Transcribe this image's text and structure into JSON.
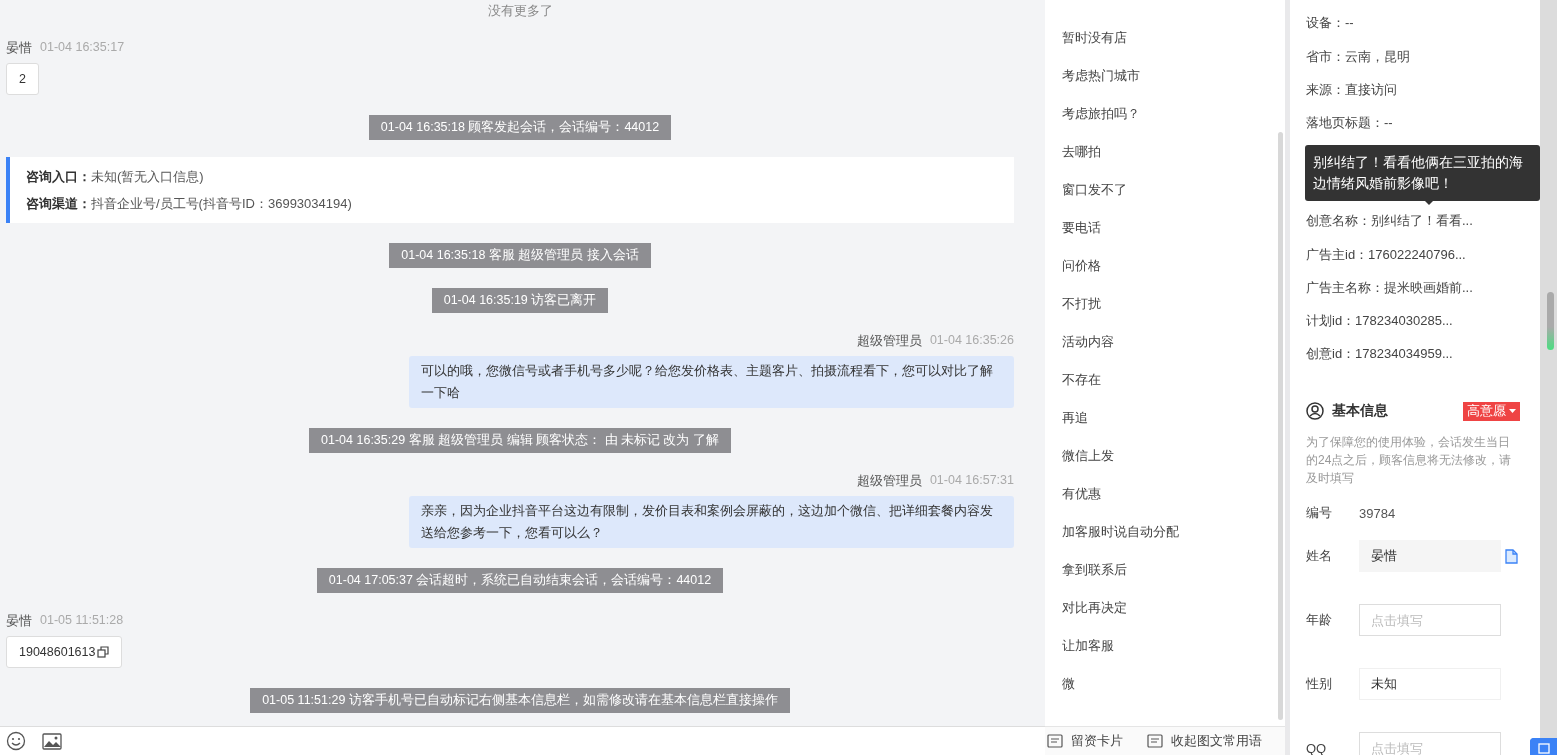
{
  "chat": {
    "end_note": "没有更多了",
    "messages": [
      {
        "kind": "visitor",
        "sender": "晏惜",
        "time": "01-04 16:35:17",
        "text": "2",
        "copy_button": false
      },
      {
        "kind": "system",
        "text": "01-04 16:35:18 顾客发起会话，会话编号：44012"
      },
      {
        "kind": "entry",
        "rows": [
          {
            "label": "咨询入口：",
            "value": "未知(暂无入口信息)"
          },
          {
            "label": "咨询渠道：",
            "value": "抖音企业号/员工号(抖音号ID：36993034194)"
          }
        ]
      },
      {
        "kind": "system",
        "text": "01-04 16:35:18 客服 超级管理员 接入会话"
      },
      {
        "kind": "system",
        "text": "01-04 16:35:19 访客已离开"
      },
      {
        "kind": "agent",
        "sender": "超级管理员",
        "time": "01-04 16:35:26",
        "text": "可以的哦，您微信号或者手机号多少呢？给您发价格表、主题客片、拍摄流程看下，您可以对比了解一下哈"
      },
      {
        "kind": "system",
        "text": "01-04 16:35:29 客服 超级管理员 编辑 顾客状态： 由 未标记 改为 了解"
      },
      {
        "kind": "agent",
        "sender": "超级管理员",
        "time": "01-04 16:57:31",
        "text": "亲亲，因为企业抖音平台这边有限制，发价目表和案例会屏蔽的，这边加个微信、把详细套餐内容发送给您参考一下，您看可以么？"
      },
      {
        "kind": "system",
        "text": "01-04 17:05:37 会话超时，系统已自动结束会话，会话编号：44012"
      },
      {
        "kind": "visitor",
        "sender": "晏惜",
        "time": "01-05 11:51:28",
        "text": "19048601613",
        "copy_button": true
      },
      {
        "kind": "system",
        "text": "01-05 11:51:29 访客手机号已自动标记右侧基本信息栏，如需修改请在基本信息栏直接操作"
      }
    ]
  },
  "quick_replies": {
    "items": [
      "暂时没有店",
      "考虑热门城市",
      "考虑旅拍吗？",
      "去哪拍",
      "窗口发不了",
      "要电话",
      "问价格",
      "不打扰",
      "活动内容",
      "不存在",
      "再追",
      "微信上发",
      "有优惠",
      "加客服时说自动分配",
      "拿到联系后",
      "对比再决定",
      "让加客服",
      "微"
    ],
    "actions": [
      "留资卡片",
      "收起图文常用语"
    ]
  },
  "visitor_info": {
    "fields_top": [
      "设备：--",
      "省市：云南，昆明",
      "来源：直接访问",
      "落地页标题：--"
    ],
    "fields_bottom": [
      "创意名称：别纠结了！看看...",
      "广告主id：176022240796...",
      "广告主名称：提米映画婚前...",
      "计划id：178234030285...",
      "创意id：178234034959..."
    ],
    "tooltip": "别纠结了！看看他俩在三亚拍的海边情绪风婚前影像吧！"
  },
  "basic_info": {
    "title": "基本信息",
    "intent": "高意愿",
    "notice": "为了保障您的使用体验，会话发生当日的24点之后，顾客信息将无法修改，请及时填写",
    "fields": [
      {
        "kind": "text",
        "label": "编号",
        "value": "39784"
      },
      {
        "kind": "filled",
        "label": "姓名",
        "value": "晏惜",
        "copy_button": true
      },
      {
        "kind": "input",
        "label": "年龄",
        "placeholder": "点击填写"
      },
      {
        "kind": "select",
        "label": "性别",
        "value": "未知"
      },
      {
        "kind": "input",
        "label": "QQ",
        "placeholder": "点击填写"
      }
    ]
  }
}
